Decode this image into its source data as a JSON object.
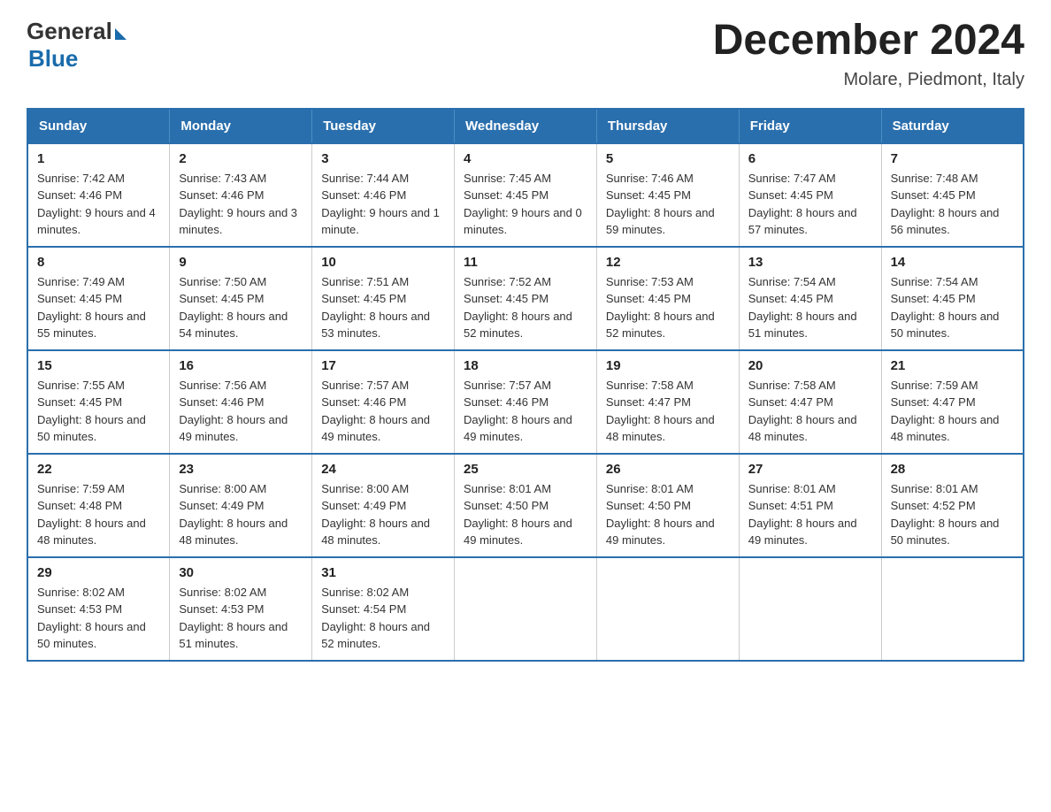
{
  "logo": {
    "text_general": "General",
    "triangle": "▶",
    "text_blue": "Blue"
  },
  "header": {
    "title": "December 2024",
    "subtitle": "Molare, Piedmont, Italy"
  },
  "days_of_week": [
    "Sunday",
    "Monday",
    "Tuesday",
    "Wednesday",
    "Thursday",
    "Friday",
    "Saturday"
  ],
  "weeks": [
    [
      {
        "day": "1",
        "sunrise": "7:42 AM",
        "sunset": "4:46 PM",
        "daylight": "9 hours and 4 minutes."
      },
      {
        "day": "2",
        "sunrise": "7:43 AM",
        "sunset": "4:46 PM",
        "daylight": "9 hours and 3 minutes."
      },
      {
        "day": "3",
        "sunrise": "7:44 AM",
        "sunset": "4:46 PM",
        "daylight": "9 hours and 1 minute."
      },
      {
        "day": "4",
        "sunrise": "7:45 AM",
        "sunset": "4:45 PM",
        "daylight": "9 hours and 0 minutes."
      },
      {
        "day": "5",
        "sunrise": "7:46 AM",
        "sunset": "4:45 PM",
        "daylight": "8 hours and 59 minutes."
      },
      {
        "day": "6",
        "sunrise": "7:47 AM",
        "sunset": "4:45 PM",
        "daylight": "8 hours and 57 minutes."
      },
      {
        "day": "7",
        "sunrise": "7:48 AM",
        "sunset": "4:45 PM",
        "daylight": "8 hours and 56 minutes."
      }
    ],
    [
      {
        "day": "8",
        "sunrise": "7:49 AM",
        "sunset": "4:45 PM",
        "daylight": "8 hours and 55 minutes."
      },
      {
        "day": "9",
        "sunrise": "7:50 AM",
        "sunset": "4:45 PM",
        "daylight": "8 hours and 54 minutes."
      },
      {
        "day": "10",
        "sunrise": "7:51 AM",
        "sunset": "4:45 PM",
        "daylight": "8 hours and 53 minutes."
      },
      {
        "day": "11",
        "sunrise": "7:52 AM",
        "sunset": "4:45 PM",
        "daylight": "8 hours and 52 minutes."
      },
      {
        "day": "12",
        "sunrise": "7:53 AM",
        "sunset": "4:45 PM",
        "daylight": "8 hours and 52 minutes."
      },
      {
        "day": "13",
        "sunrise": "7:54 AM",
        "sunset": "4:45 PM",
        "daylight": "8 hours and 51 minutes."
      },
      {
        "day": "14",
        "sunrise": "7:54 AM",
        "sunset": "4:45 PM",
        "daylight": "8 hours and 50 minutes."
      }
    ],
    [
      {
        "day": "15",
        "sunrise": "7:55 AM",
        "sunset": "4:45 PM",
        "daylight": "8 hours and 50 minutes."
      },
      {
        "day": "16",
        "sunrise": "7:56 AM",
        "sunset": "4:46 PM",
        "daylight": "8 hours and 49 minutes."
      },
      {
        "day": "17",
        "sunrise": "7:57 AM",
        "sunset": "4:46 PM",
        "daylight": "8 hours and 49 minutes."
      },
      {
        "day": "18",
        "sunrise": "7:57 AM",
        "sunset": "4:46 PM",
        "daylight": "8 hours and 49 minutes."
      },
      {
        "day": "19",
        "sunrise": "7:58 AM",
        "sunset": "4:47 PM",
        "daylight": "8 hours and 48 minutes."
      },
      {
        "day": "20",
        "sunrise": "7:58 AM",
        "sunset": "4:47 PM",
        "daylight": "8 hours and 48 minutes."
      },
      {
        "day": "21",
        "sunrise": "7:59 AM",
        "sunset": "4:47 PM",
        "daylight": "8 hours and 48 minutes."
      }
    ],
    [
      {
        "day": "22",
        "sunrise": "7:59 AM",
        "sunset": "4:48 PM",
        "daylight": "8 hours and 48 minutes."
      },
      {
        "day": "23",
        "sunrise": "8:00 AM",
        "sunset": "4:49 PM",
        "daylight": "8 hours and 48 minutes."
      },
      {
        "day": "24",
        "sunrise": "8:00 AM",
        "sunset": "4:49 PM",
        "daylight": "8 hours and 48 minutes."
      },
      {
        "day": "25",
        "sunrise": "8:01 AM",
        "sunset": "4:50 PM",
        "daylight": "8 hours and 49 minutes."
      },
      {
        "day": "26",
        "sunrise": "8:01 AM",
        "sunset": "4:50 PM",
        "daylight": "8 hours and 49 minutes."
      },
      {
        "day": "27",
        "sunrise": "8:01 AM",
        "sunset": "4:51 PM",
        "daylight": "8 hours and 49 minutes."
      },
      {
        "day": "28",
        "sunrise": "8:01 AM",
        "sunset": "4:52 PM",
        "daylight": "8 hours and 50 minutes."
      }
    ],
    [
      {
        "day": "29",
        "sunrise": "8:02 AM",
        "sunset": "4:53 PM",
        "daylight": "8 hours and 50 minutes."
      },
      {
        "day": "30",
        "sunrise": "8:02 AM",
        "sunset": "4:53 PM",
        "daylight": "8 hours and 51 minutes."
      },
      {
        "day": "31",
        "sunrise": "8:02 AM",
        "sunset": "4:54 PM",
        "daylight": "8 hours and 52 minutes."
      },
      null,
      null,
      null,
      null
    ]
  ],
  "labels": {
    "sunrise_prefix": "Sunrise: ",
    "sunset_prefix": "Sunset: ",
    "daylight_prefix": "Daylight: "
  }
}
